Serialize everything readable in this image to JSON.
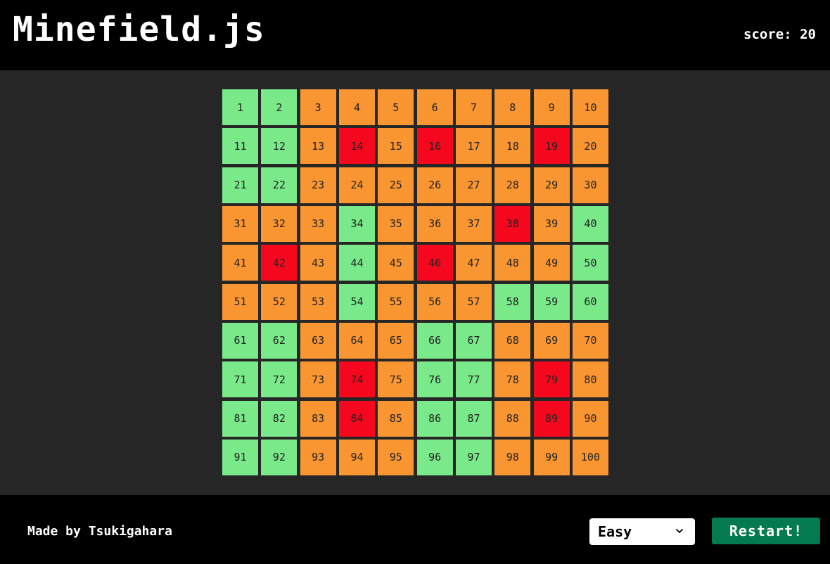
{
  "header": {
    "title": "Minefield.js",
    "score_label": "score:",
    "score_value": "20"
  },
  "board": {
    "rows": 10,
    "cols": 10,
    "colors": {
      "safe": "#79e98a",
      "hidden": "#fa9632",
      "mine": "#f5081e"
    },
    "cells": [
      {
        "n": "1",
        "s": "safe"
      },
      {
        "n": "2",
        "s": "safe"
      },
      {
        "n": "3",
        "s": "hidden"
      },
      {
        "n": "4",
        "s": "hidden"
      },
      {
        "n": "5",
        "s": "hidden"
      },
      {
        "n": "6",
        "s": "hidden"
      },
      {
        "n": "7",
        "s": "hidden"
      },
      {
        "n": "8",
        "s": "hidden"
      },
      {
        "n": "9",
        "s": "hidden"
      },
      {
        "n": "10",
        "s": "hidden"
      },
      {
        "n": "11",
        "s": "safe"
      },
      {
        "n": "12",
        "s": "safe"
      },
      {
        "n": "13",
        "s": "hidden"
      },
      {
        "n": "14",
        "s": "mine"
      },
      {
        "n": "15",
        "s": "hidden"
      },
      {
        "n": "16",
        "s": "mine"
      },
      {
        "n": "17",
        "s": "hidden"
      },
      {
        "n": "18",
        "s": "hidden"
      },
      {
        "n": "19",
        "s": "mine"
      },
      {
        "n": "20",
        "s": "hidden"
      },
      {
        "n": "21",
        "s": "safe"
      },
      {
        "n": "22",
        "s": "safe"
      },
      {
        "n": "23",
        "s": "hidden"
      },
      {
        "n": "24",
        "s": "hidden"
      },
      {
        "n": "25",
        "s": "hidden"
      },
      {
        "n": "26",
        "s": "hidden"
      },
      {
        "n": "27",
        "s": "hidden"
      },
      {
        "n": "28",
        "s": "hidden"
      },
      {
        "n": "29",
        "s": "hidden"
      },
      {
        "n": "30",
        "s": "hidden"
      },
      {
        "n": "31",
        "s": "hidden"
      },
      {
        "n": "32",
        "s": "hidden"
      },
      {
        "n": "33",
        "s": "hidden"
      },
      {
        "n": "34",
        "s": "safe"
      },
      {
        "n": "35",
        "s": "hidden"
      },
      {
        "n": "36",
        "s": "hidden"
      },
      {
        "n": "37",
        "s": "hidden"
      },
      {
        "n": "38",
        "s": "mine"
      },
      {
        "n": "39",
        "s": "hidden"
      },
      {
        "n": "40",
        "s": "safe"
      },
      {
        "n": "41",
        "s": "hidden"
      },
      {
        "n": "42",
        "s": "mine"
      },
      {
        "n": "43",
        "s": "hidden"
      },
      {
        "n": "44",
        "s": "safe"
      },
      {
        "n": "45",
        "s": "hidden"
      },
      {
        "n": "46",
        "s": "mine"
      },
      {
        "n": "47",
        "s": "hidden"
      },
      {
        "n": "48",
        "s": "hidden"
      },
      {
        "n": "49",
        "s": "hidden"
      },
      {
        "n": "50",
        "s": "safe"
      },
      {
        "n": "51",
        "s": "hidden"
      },
      {
        "n": "52",
        "s": "hidden"
      },
      {
        "n": "53",
        "s": "hidden"
      },
      {
        "n": "54",
        "s": "safe"
      },
      {
        "n": "55",
        "s": "hidden"
      },
      {
        "n": "56",
        "s": "hidden"
      },
      {
        "n": "57",
        "s": "hidden"
      },
      {
        "n": "58",
        "s": "safe"
      },
      {
        "n": "59",
        "s": "safe"
      },
      {
        "n": "60",
        "s": "safe"
      },
      {
        "n": "61",
        "s": "safe"
      },
      {
        "n": "62",
        "s": "safe"
      },
      {
        "n": "63",
        "s": "hidden"
      },
      {
        "n": "64",
        "s": "hidden"
      },
      {
        "n": "65",
        "s": "hidden"
      },
      {
        "n": "66",
        "s": "safe"
      },
      {
        "n": "67",
        "s": "safe"
      },
      {
        "n": "68",
        "s": "hidden"
      },
      {
        "n": "69",
        "s": "hidden"
      },
      {
        "n": "70",
        "s": "hidden"
      },
      {
        "n": "71",
        "s": "safe"
      },
      {
        "n": "72",
        "s": "safe"
      },
      {
        "n": "73",
        "s": "hidden"
      },
      {
        "n": "74",
        "s": "mine"
      },
      {
        "n": "75",
        "s": "hidden"
      },
      {
        "n": "76",
        "s": "safe"
      },
      {
        "n": "77",
        "s": "safe"
      },
      {
        "n": "78",
        "s": "hidden"
      },
      {
        "n": "79",
        "s": "mine"
      },
      {
        "n": "80",
        "s": "hidden"
      },
      {
        "n": "81",
        "s": "safe"
      },
      {
        "n": "82",
        "s": "safe"
      },
      {
        "n": "83",
        "s": "hidden"
      },
      {
        "n": "84",
        "s": "mine"
      },
      {
        "n": "85",
        "s": "hidden"
      },
      {
        "n": "86",
        "s": "safe"
      },
      {
        "n": "87",
        "s": "safe"
      },
      {
        "n": "88",
        "s": "hidden"
      },
      {
        "n": "89",
        "s": "mine"
      },
      {
        "n": "90",
        "s": "hidden"
      },
      {
        "n": "91",
        "s": "safe"
      },
      {
        "n": "92",
        "s": "safe"
      },
      {
        "n": "93",
        "s": "hidden"
      },
      {
        "n": "94",
        "s": "hidden"
      },
      {
        "n": "95",
        "s": "hidden"
      },
      {
        "n": "96",
        "s": "safe"
      },
      {
        "n": "97",
        "s": "safe"
      },
      {
        "n": "98",
        "s": "hidden"
      },
      {
        "n": "99",
        "s": "hidden"
      },
      {
        "n": "100",
        "s": "hidden"
      }
    ]
  },
  "footer": {
    "credit": "Made by Tsukigahara",
    "difficulty": {
      "selected": "Easy",
      "icon": "chevron-down-icon"
    },
    "restart_label": "Restart!"
  },
  "colors": {
    "page_background": "#000000",
    "board_area_background": "#262626",
    "restart_button": "#047a4f"
  }
}
